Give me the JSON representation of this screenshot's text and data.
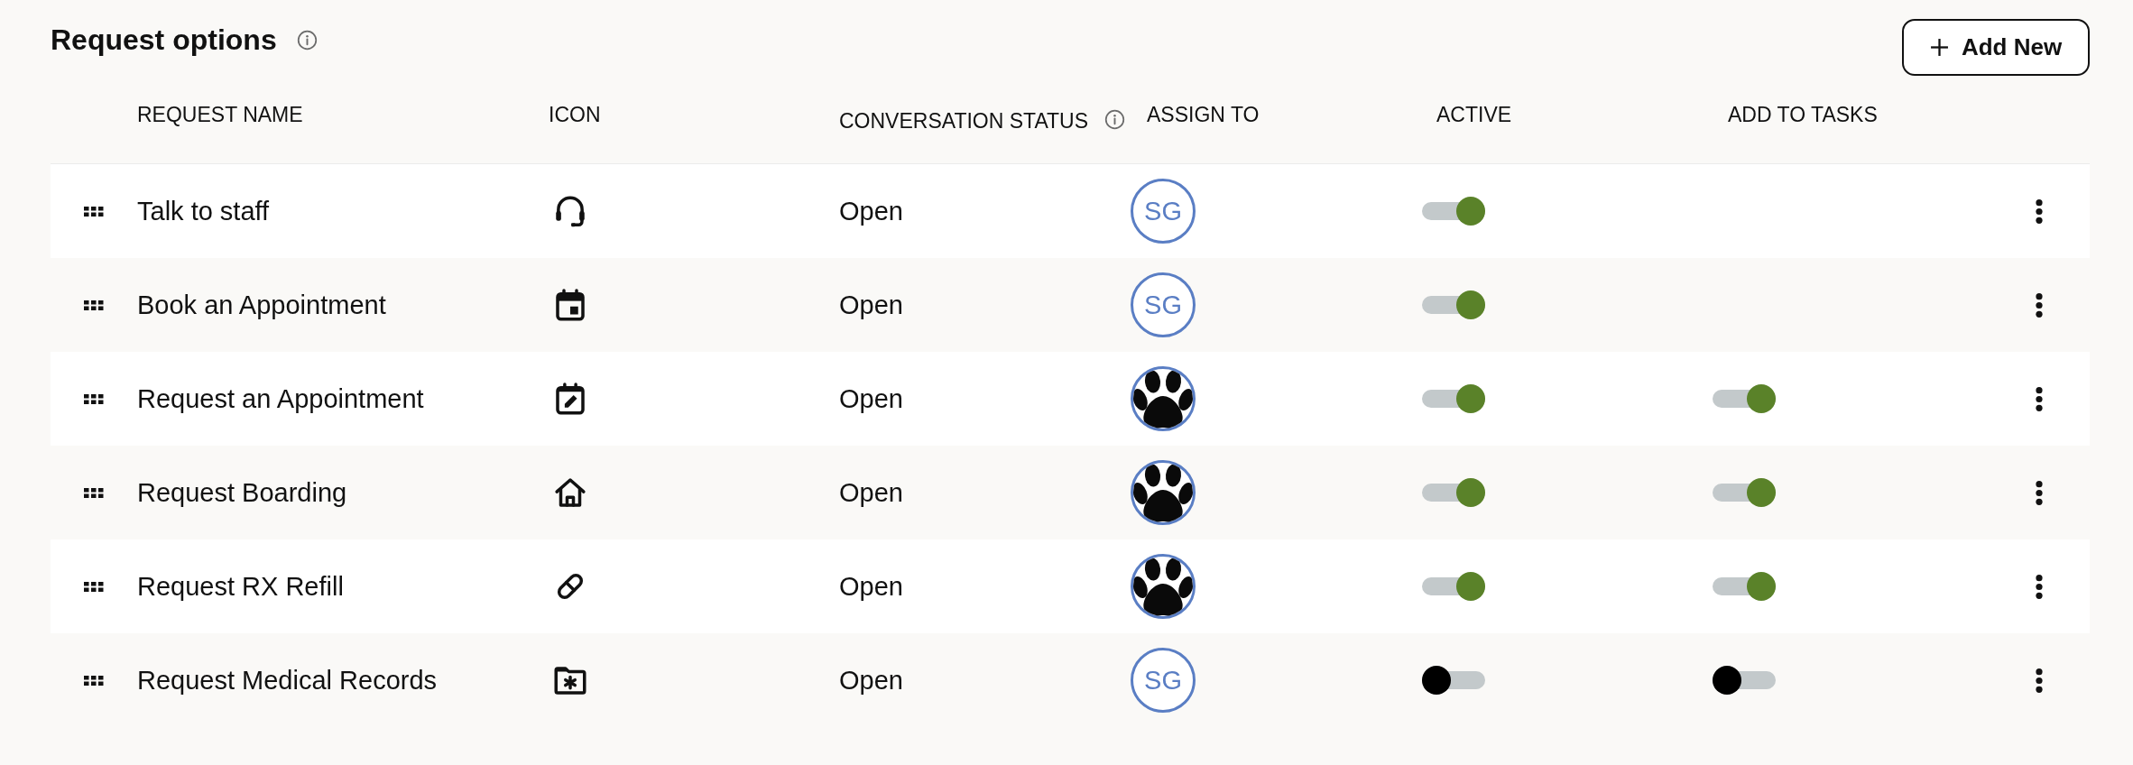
{
  "header": {
    "title": "Request options",
    "info": true,
    "add_button": {
      "label": "Add New"
    }
  },
  "table": {
    "columns": [
      {
        "label": "REQUEST NAME"
      },
      {
        "label": "ICON"
      },
      {
        "label": "CONVERSATION STATUS",
        "info": true
      },
      {
        "label": "ASSIGN TO"
      },
      {
        "label": "ACTIVE"
      },
      {
        "label": "ADD TO TASKS"
      }
    ],
    "rows": [
      {
        "name": "Talk to staff",
        "icon": {
          "kind": "headset"
        },
        "status": "Open",
        "assignee": {
          "kind": "initials",
          "text": "SG"
        },
        "active": true
      },
      {
        "name": "Book an Appointment",
        "icon": {
          "kind": "calendar"
        },
        "status": "Open",
        "assignee": {
          "kind": "initials",
          "text": "SG"
        },
        "active": true
      },
      {
        "name": "Request an Appointment",
        "icon": {
          "kind": "calendar-edit"
        },
        "status": "Open",
        "assignee": {
          "kind": "paw"
        },
        "active": true,
        "add_to_tasks": true
      },
      {
        "name": "Request Boarding",
        "icon": {
          "kind": "house"
        },
        "status": "Open",
        "assignee": {
          "kind": "paw"
        },
        "active": true,
        "add_to_tasks": true
      },
      {
        "name": "Request RX Refill",
        "icon": {
          "kind": "pill"
        },
        "status": "Open",
        "assignee": {
          "kind": "paw"
        },
        "active": true,
        "add_to_tasks": true
      },
      {
        "name": "Request Medical Records",
        "icon": {
          "kind": "folder-asterisk"
        },
        "status": "Open",
        "assignee": {
          "kind": "initials",
          "text": "SG"
        },
        "active": false,
        "add_to_tasks": false
      }
    ]
  }
}
